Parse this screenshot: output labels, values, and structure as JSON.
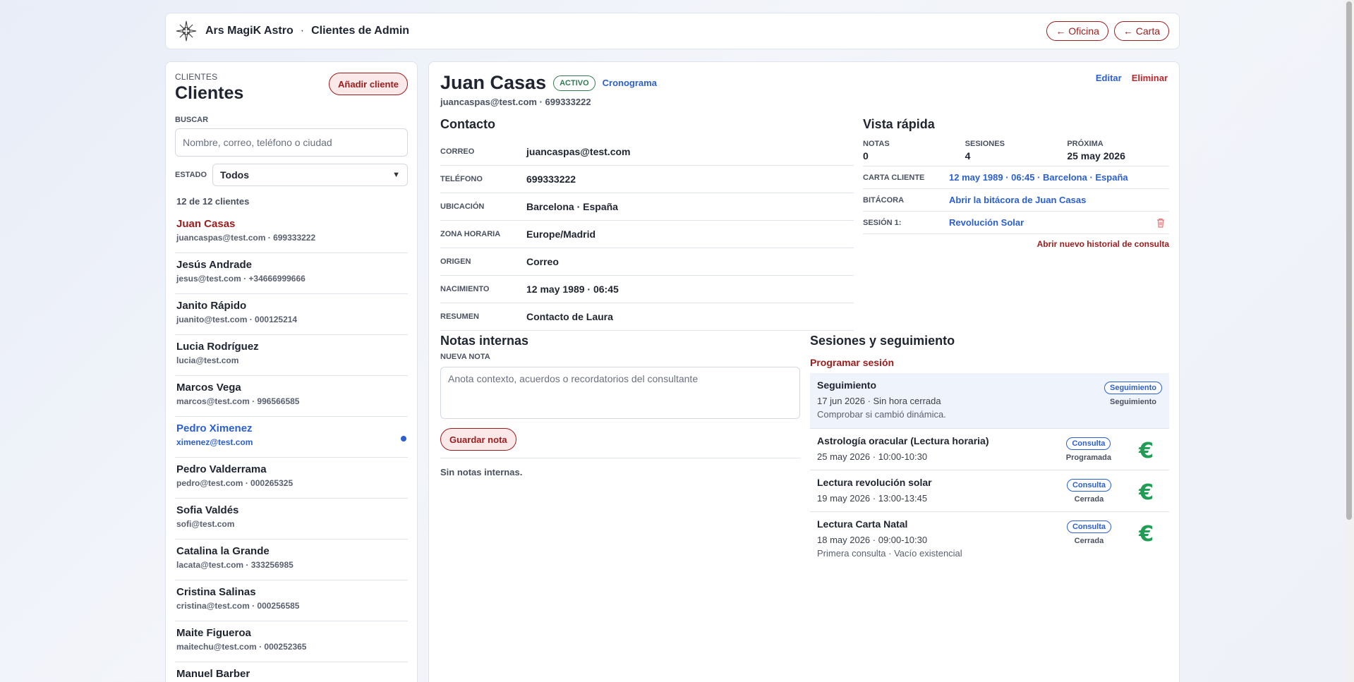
{
  "header": {
    "brand": "Ars MagiK Astro",
    "separator": "·",
    "section": "Clientes de Admin",
    "buttons": {
      "oficina": "← Oficina",
      "carta": "← Carta"
    },
    "logo_icon": "compass-star-icon"
  },
  "sidebar": {
    "eyebrow": "CLIENTES",
    "title": "Clientes",
    "add_label": "Añadir cliente",
    "search_label": "BUSCAR",
    "search_placeholder": "Nombre, correo, teléfono o ciudad",
    "estado_label": "ESTADO",
    "estado_value": "Todos",
    "count": "12 de 12 clientes",
    "clients": [
      {
        "name": "Juan Casas",
        "meta": "juancaspas@test.com · 699333222"
      },
      {
        "name": "Jesús Andrade",
        "meta": "jesus@test.com · +34666999666"
      },
      {
        "name": "Janito Rápido",
        "meta": "juanito@test.com · 000125214"
      },
      {
        "name": "Lucia Rodríguez",
        "meta": "lucia@test.com"
      },
      {
        "name": "Marcos Vega",
        "meta": "marcos@test.com · 996566585"
      },
      {
        "name": "Pedro Ximenez",
        "meta": "ximenez@test.com"
      },
      {
        "name": "Pedro Valderrama",
        "meta": "pedro@test.com · 000265325"
      },
      {
        "name": "Sofia Valdés",
        "meta": "sofi@test.com"
      },
      {
        "name": "Catalina la Grande",
        "meta": "lacata@test.com · 333256985"
      },
      {
        "name": "Cristina Salinas",
        "meta": "cristina@test.com · 000256585"
      },
      {
        "name": "Maite Figueroa",
        "meta": "maitechu@test.com · 000252365"
      },
      {
        "name": "Manuel Barber",
        "meta": ""
      }
    ]
  },
  "client": {
    "name": "Juan Casas",
    "status": "ACTIVO",
    "cronograma": "Cronograma",
    "subtitle": "juancaspas@test.com · 699333222",
    "edit": "Editar",
    "delete": "Eliminar"
  },
  "contact": {
    "title": "Contacto",
    "rows": [
      {
        "k": "CORREO",
        "v": "juancaspas@test.com"
      },
      {
        "k": "TELÉFONO",
        "v": "699333222"
      },
      {
        "k": "UBICACIÓN",
        "v": "Barcelona · España"
      },
      {
        "k": "ZONA HORARIA",
        "v": "Europe/Madrid"
      },
      {
        "k": "ORIGEN",
        "v": "Correo"
      },
      {
        "k": "NACIMIENTO",
        "v": "12 may 1989 · 06:45"
      },
      {
        "k": "RESUMEN",
        "v": "Contacto de Laura"
      }
    ]
  },
  "quick": {
    "title": "Vista rápida",
    "stats": [
      {
        "label": "NOTAS",
        "value": "0"
      },
      {
        "label": "SESIONES",
        "value": "4"
      },
      {
        "label": "PRÓXIMA",
        "value": "25 may 2026"
      }
    ],
    "carta_label": "CARTA CLIENTE",
    "carta_value": "12 may 1989 · 06:45 · Barcelona · España",
    "bitacora_label": "BITÁCORA",
    "bitacora_value": "Abrir la bitácora de Juan Casas",
    "sesion_label": "SESIÓN 1:",
    "sesion_value": "Revolución Solar",
    "new_history": "Abrir nuevo historial de consulta"
  },
  "notes": {
    "title": "Notas internas",
    "new_label": "NUEVA NOTA",
    "placeholder": "Anota contexto, acuerdos o recordatorios del consultante",
    "save": "Guardar nota",
    "empty": "Sin notas internas."
  },
  "sessions": {
    "title": "Sesiones y seguimiento",
    "program": "Programar sesión",
    "euro": "€",
    "items": [
      {
        "title": "Seguimiento",
        "date": "17 jun 2026 · Sin hora cerrada",
        "note": "Comprobar si cambió dinámica.",
        "tag": "Seguimiento",
        "state": "Seguimiento"
      },
      {
        "title": "Astrología oracular (Lectura horaria)",
        "date": "25 may 2026 · 10:00-10:30",
        "note": "",
        "tag": "Consulta",
        "state": "Programada"
      },
      {
        "title": "Lectura revolución solar",
        "date": "19 may 2026 · 13:00-13:45",
        "note": "",
        "tag": "Consulta",
        "state": "Cerrada"
      },
      {
        "title": "Lectura Carta Natal",
        "date": "18 may 2026 · 09:00-10:30",
        "note": "Primera consulta · Vacío existencial",
        "tag": "Consulta",
        "state": "Cerrada"
      }
    ]
  },
  "colors": {
    "accent": "#9b1c1c",
    "link": "#2b5fd0",
    "success": "#1f9d55"
  }
}
